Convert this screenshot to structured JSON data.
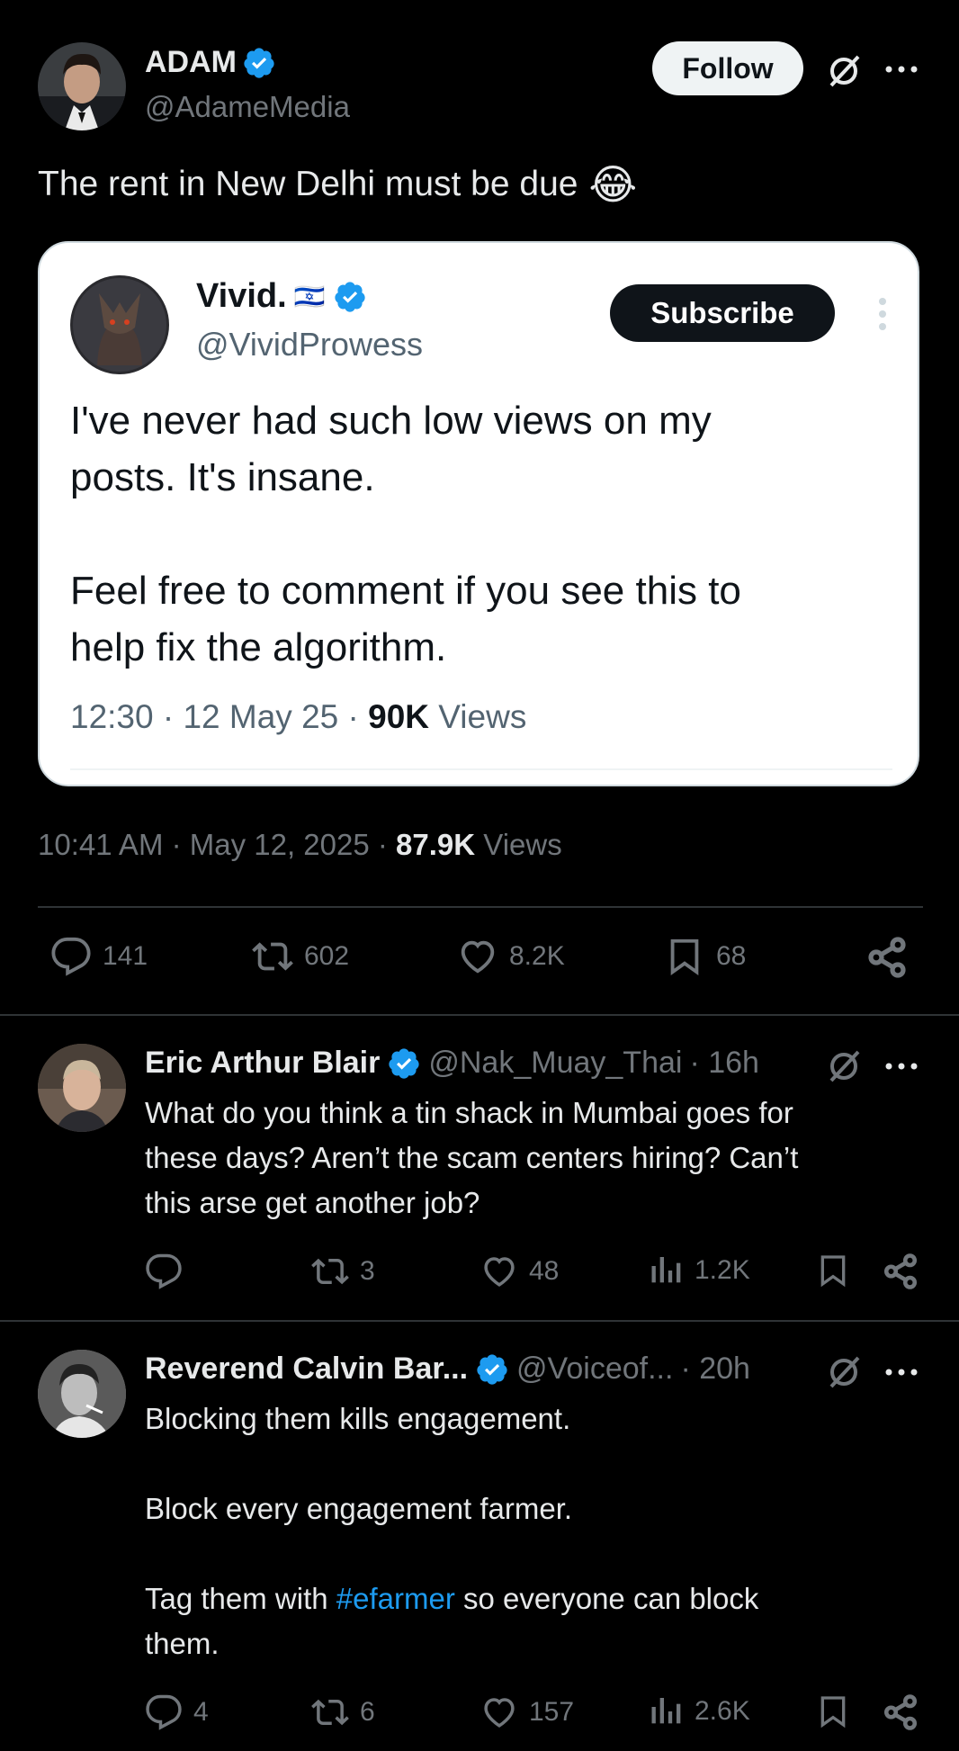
{
  "main_post": {
    "author_name": "ADAM",
    "handle": "@AdameMedia",
    "follow_label": "Follow",
    "text": "The rent in New Delhi must be due",
    "emoji": "😂",
    "timestamp": "10:41 AM · May 12, 2025 · ",
    "views_count": "87.9K",
    "views_label": "Views",
    "stats": {
      "replies": "141",
      "reposts": "602",
      "likes": "8.2K",
      "bookmarks": "68"
    }
  },
  "quoted_post": {
    "author_name": "Vivid.",
    "flag": "🇮🇱",
    "handle": "@VividProwess",
    "subscribe_label": "Subscribe",
    "text_line1": "I've never had such low views on my",
    "text_line2": "posts. It's insane.",
    "text_line3": "Feel free to comment if you see this to",
    "text_line4": "help fix the algorithm.",
    "meta": "12:30 · 12 May 25 · ",
    "views_count": "90K",
    "views_label": "Views"
  },
  "replies": [
    {
      "author_name": "Eric Arthur Blair",
      "handle": "@Nak_Muay_Thai",
      "time": "· 16h",
      "text_line1": "What do you think a tin shack in Mumbai goes for",
      "text_line2": "these days? Aren’t the scam centers hiring? Can’t",
      "text_line3": "this arse get another job?",
      "stats": {
        "replies": "",
        "reposts": "3",
        "likes": "48",
        "views": "1.2K"
      }
    },
    {
      "author_name": "Reverend Calvin Bar...",
      "handle": "@Voiceof...",
      "time": "· 20h",
      "text_line1": "Blocking them kills engagement.",
      "text_line2": "Block every engagement farmer.",
      "text_line3_pre": "Tag them with ",
      "hashtag": "#efarmer",
      "text_line3_post": " so everyone can block",
      "text_line4": "them.",
      "stats": {
        "replies": "4",
        "reposts": "6",
        "likes": "157",
        "views": "2.6K"
      }
    }
  ],
  "colors": {
    "background": "#000000",
    "verified": "#1d9bf0",
    "secondary_text": "#71767b",
    "link": "#1d9bf0"
  }
}
